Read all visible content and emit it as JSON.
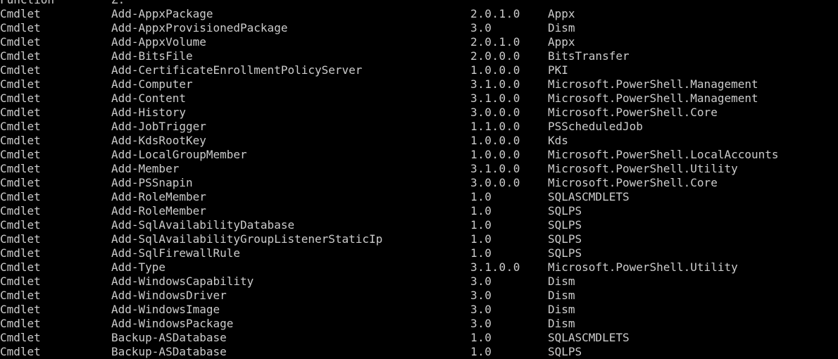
{
  "window": {
    "background": "#000000",
    "foreground": "#cccccc"
  },
  "partial_row": {
    "type": "Function",
    "name": "Z:"
  },
  "rows": [
    {
      "type": "Cmdlet",
      "name": "Add-AppxPackage",
      "version": "2.0.1.0",
      "source": "Appx"
    },
    {
      "type": "Cmdlet",
      "name": "Add-AppxProvisionedPackage",
      "version": "3.0",
      "source": "Dism"
    },
    {
      "type": "Cmdlet",
      "name": "Add-AppxVolume",
      "version": "2.0.1.0",
      "source": "Appx"
    },
    {
      "type": "Cmdlet",
      "name": "Add-BitsFile",
      "version": "2.0.0.0",
      "source": "BitsTransfer"
    },
    {
      "type": "Cmdlet",
      "name": "Add-CertificateEnrollmentPolicyServer",
      "version": "1.0.0.0",
      "source": "PKI"
    },
    {
      "type": "Cmdlet",
      "name": "Add-Computer",
      "version": "3.1.0.0",
      "source": "Microsoft.PowerShell.Management"
    },
    {
      "type": "Cmdlet",
      "name": "Add-Content",
      "version": "3.1.0.0",
      "source": "Microsoft.PowerShell.Management"
    },
    {
      "type": "Cmdlet",
      "name": "Add-History",
      "version": "3.0.0.0",
      "source": "Microsoft.PowerShell.Core"
    },
    {
      "type": "Cmdlet",
      "name": "Add-JobTrigger",
      "version": "1.1.0.0",
      "source": "PSScheduledJob"
    },
    {
      "type": "Cmdlet",
      "name": "Add-KdsRootKey",
      "version": "1.0.0.0",
      "source": "Kds"
    },
    {
      "type": "Cmdlet",
      "name": "Add-LocalGroupMember",
      "version": "1.0.0.0",
      "source": "Microsoft.PowerShell.LocalAccounts"
    },
    {
      "type": "Cmdlet",
      "name": "Add-Member",
      "version": "3.1.0.0",
      "source": "Microsoft.PowerShell.Utility"
    },
    {
      "type": "Cmdlet",
      "name": "Add-PSSnapin",
      "version": "3.0.0.0",
      "source": "Microsoft.PowerShell.Core"
    },
    {
      "type": "Cmdlet",
      "name": "Add-RoleMember",
      "version": "1.0",
      "source": "SQLASCMDLETS"
    },
    {
      "type": "Cmdlet",
      "name": "Add-RoleMember",
      "version": "1.0",
      "source": "SQLPS"
    },
    {
      "type": "Cmdlet",
      "name": "Add-SqlAvailabilityDatabase",
      "version": "1.0",
      "source": "SQLPS"
    },
    {
      "type": "Cmdlet",
      "name": "Add-SqlAvailabilityGroupListenerStaticIp",
      "version": "1.0",
      "source": "SQLPS"
    },
    {
      "type": "Cmdlet",
      "name": "Add-SqlFirewallRule",
      "version": "1.0",
      "source": "SQLPS"
    },
    {
      "type": "Cmdlet",
      "name": "Add-Type",
      "version": "3.1.0.0",
      "source": "Microsoft.PowerShell.Utility"
    },
    {
      "type": "Cmdlet",
      "name": "Add-WindowsCapability",
      "version": "3.0",
      "source": "Dism"
    },
    {
      "type": "Cmdlet",
      "name": "Add-WindowsDriver",
      "version": "3.0",
      "source": "Dism"
    },
    {
      "type": "Cmdlet",
      "name": "Add-WindowsImage",
      "version": "3.0",
      "source": "Dism"
    },
    {
      "type": "Cmdlet",
      "name": "Add-WindowsPackage",
      "version": "3.0",
      "source": "Dism"
    },
    {
      "type": "Cmdlet",
      "name": "Backup-ASDatabase",
      "version": "1.0",
      "source": "SQLASCMDLETS"
    },
    {
      "type": "Cmdlet",
      "name": "Backup-ASDatabase",
      "version": "1.0",
      "source": "SQLPS"
    }
  ]
}
